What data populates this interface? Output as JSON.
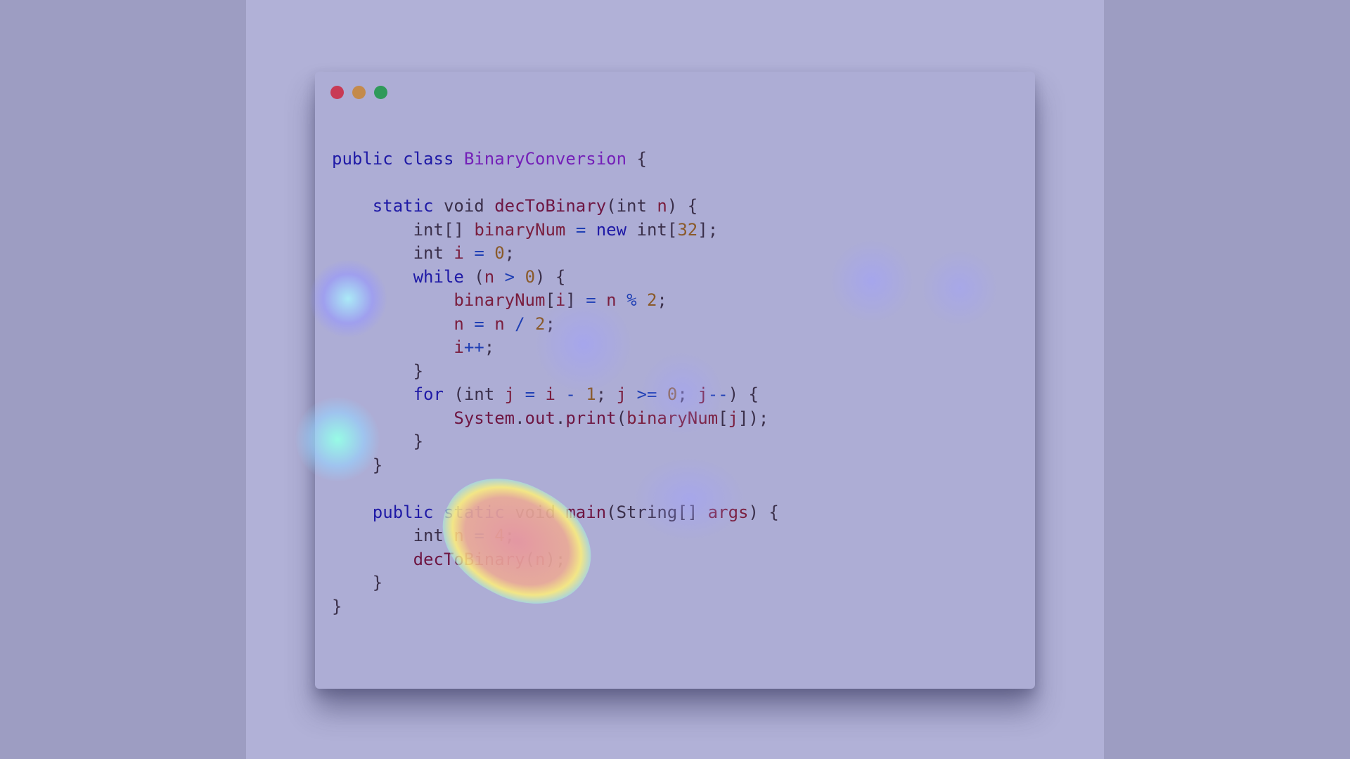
{
  "window": {
    "controls": [
      "close",
      "minimize",
      "maximize"
    ]
  },
  "code_lines": [
    "public class BinaryConversion {",
    "",
    "    static void decToBinary(int n) {",
    "        int[] binaryNum = new int[32];",
    "        int i = 0;",
    "        while (n > 0) {",
    "            binaryNum[i] = n % 2;",
    "            n = n / 2;",
    "            i++;",
    "        }",
    "        for (int j = i - 1; j >= 0; j--) {",
    "            System.out.print(binaryNum[j]);",
    "        }",
    "    }",
    "",
    "    public static void main(String[] args) {",
    "        int n = 4;",
    "        decToBinary(n);",
    "    }",
    "}"
  ],
  "colors": {
    "keyword": "#1f1aa6",
    "class_name": "#7420b8",
    "function": "#6e1642",
    "variable": "#7a1d3d",
    "number": "#8a5a2a",
    "operator": "#1f3fb4"
  }
}
